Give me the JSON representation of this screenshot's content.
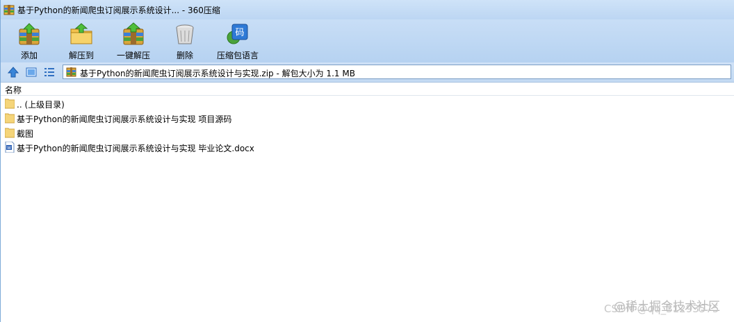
{
  "window": {
    "title": "基于Python的新闻爬虫订阅展示系统设计... - 360压缩"
  },
  "toolbar": {
    "buttons": [
      {
        "label": "添加",
        "icon": "add-archive-icon"
      },
      {
        "label": "解压到",
        "icon": "extract-to-icon"
      },
      {
        "label": "一键解压",
        "icon": "one-click-extract-icon"
      },
      {
        "label": "删除",
        "icon": "delete-trash-icon"
      },
      {
        "label": "压缩包语言",
        "icon": "archive-language-icon"
      }
    ],
    "language_badge": "码"
  },
  "address_bar": {
    "path": "基于Python的新闻爬虫订阅展示系统设计与实现.zip - 解包大小为 1.1 MB"
  },
  "file_list": {
    "column_name": "名称",
    "items": [
      {
        "name": ".. (上级目录)",
        "type": "folder"
      },
      {
        "name": "基于Python的新闻爬虫订阅展示系统设计与实现 项目源码",
        "type": "folder"
      },
      {
        "name": "截图",
        "type": "folder"
      },
      {
        "name": "基于Python的新闻爬虫订阅展示系统设计与实现 毕业论文.docx",
        "type": "docx"
      }
    ]
  },
  "watermark": {
    "line1": "@稀土掘金技术社区",
    "line2": "CSDN @qq_31293575"
  },
  "colors": {
    "toolbar_bg": "#c8def6",
    "folder": "#f5d57a",
    "docx": "#2b5fb4"
  }
}
